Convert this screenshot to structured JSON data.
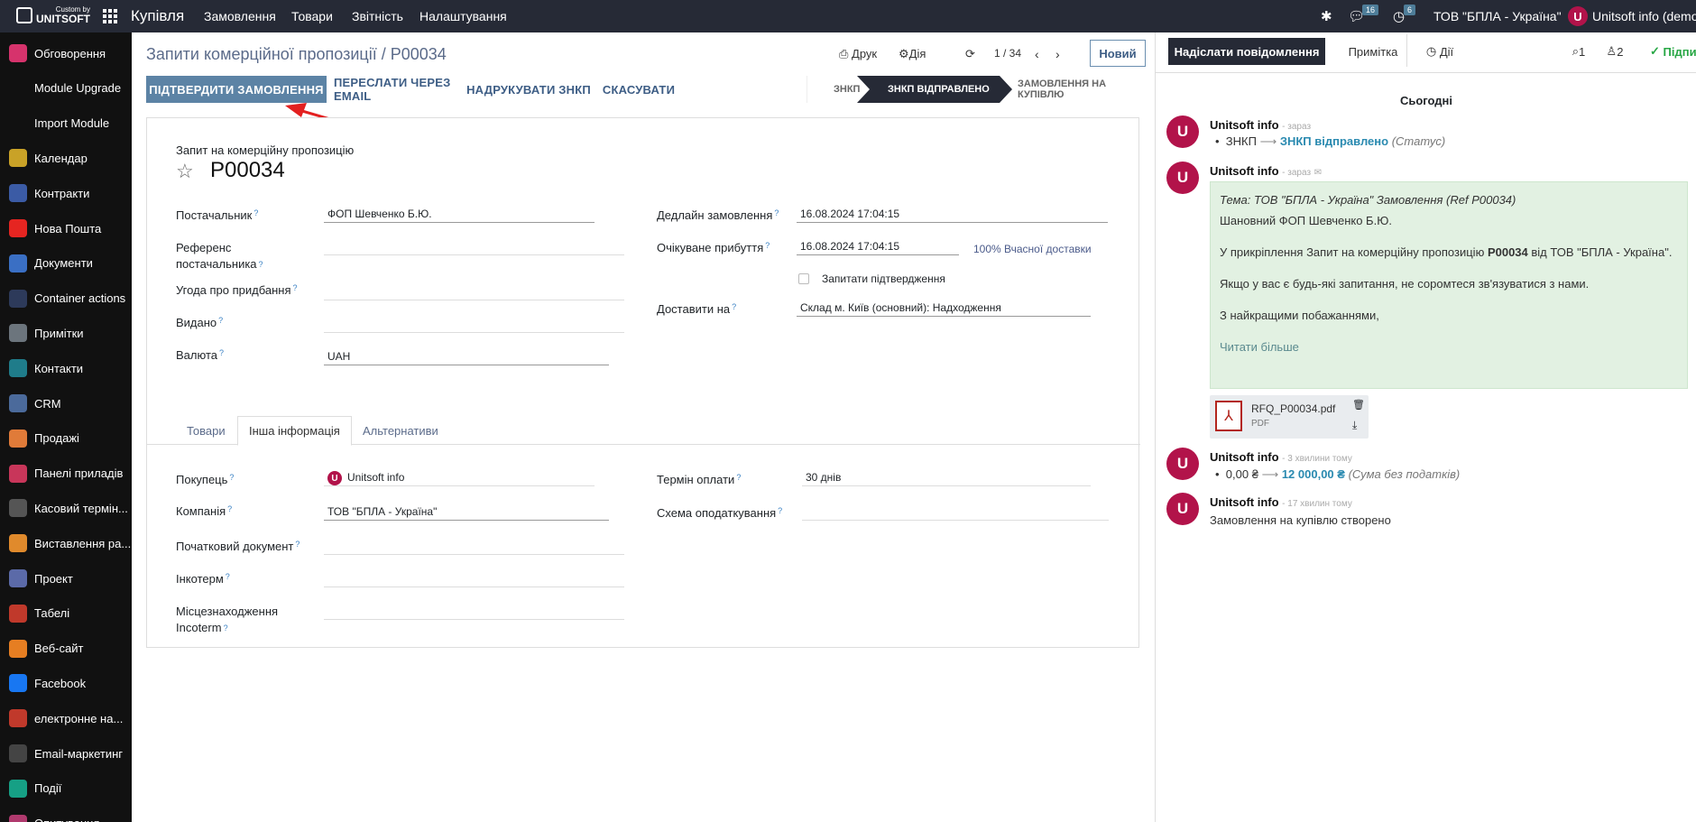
{
  "topbar": {
    "brand_small": "Custom by",
    "brand_name": "UNITSOFT",
    "app": "Купівля",
    "menu": [
      "Замовлення",
      "Товари",
      "Звітність",
      "Налаштування"
    ],
    "messages_count": "16",
    "activities_count": "6",
    "company": "ТОВ \"БПЛА - Україна\"",
    "user_initial": "U",
    "user": "Unitsoft info (demos"
  },
  "sidebar": {
    "items": [
      {
        "label": "Обговорення",
        "icon": "discuss-icon",
        "color": "#d6336c"
      },
      {
        "label": "Module Upgrade",
        "icon": "",
        "color": ""
      },
      {
        "label": "Import Module",
        "icon": "",
        "color": ""
      },
      {
        "label": "Календар",
        "icon": "calendar-icon",
        "color": "#c9a227"
      },
      {
        "label": "Контракти",
        "icon": "contracts-icon",
        "color": "#3b5ba5"
      },
      {
        "label": "Нова Пошта",
        "icon": "nova-poshta-icon",
        "color": "#e52521"
      },
      {
        "label": "Документи",
        "icon": "documents-icon",
        "color": "#3a6fc4"
      },
      {
        "label": "Container actions",
        "icon": "container-icon",
        "color": "#2d3a5a"
      },
      {
        "label": "Примітки",
        "icon": "notes-icon",
        "color": "#6c757d"
      },
      {
        "label": "Контакти",
        "icon": "contacts-icon",
        "color": "#1f7c8a"
      },
      {
        "label": "CRM",
        "icon": "crm-icon",
        "color": "#4b6a9b"
      },
      {
        "label": "Продажі",
        "icon": "sales-icon",
        "color": "#e07b39"
      },
      {
        "label": "Панелі приладів",
        "icon": "dashboards-icon",
        "color": "#c8365a"
      },
      {
        "label": "Касовий термін...",
        "icon": "pos-icon",
        "color": "#555"
      },
      {
        "label": "Виставлення ра...",
        "icon": "invoicing-icon",
        "color": "#e08a2c"
      },
      {
        "label": "Проект",
        "icon": "project-icon",
        "color": "#5b6aa8"
      },
      {
        "label": "Табелі",
        "icon": "timesheets-icon",
        "color": "#c0392b"
      },
      {
        "label": "Веб-сайт",
        "icon": "website-icon",
        "color": "#e67e22"
      },
      {
        "label": "Facebook",
        "icon": "facebook-icon",
        "color": "#1877f2"
      },
      {
        "label": "електронне на...",
        "icon": "elearning-icon",
        "color": "#c0392b"
      },
      {
        "label": "Email-маркетинг",
        "icon": "email-marketing-icon",
        "color": "#444"
      },
      {
        "label": "Події",
        "icon": "events-icon",
        "color": "#16a085"
      },
      {
        "label": "Опитування",
        "icon": "surveys-icon",
        "color": "#b03a6e"
      }
    ]
  },
  "header": {
    "breadcrumb": "Запити комерційної пропозиції / P00034",
    "print": "Друк",
    "action": "Дія",
    "pager": "1 / 34",
    "new": "Новий"
  },
  "statusbar": {
    "confirm": "ПІДТВЕРДИТИ ЗАМОВЛЕННЯ",
    "send_email": "ПЕРЕСЛАТИ ЧЕРЕЗ EMAIL",
    "print_rfq": "НАДРУКУВАТИ ЗНКП",
    "cancel": "СКАСУВАТИ",
    "stages": [
      "ЗНКП",
      "ЗНКП ВІДПРАВЛЕНО",
      "ЗАМОВЛЕННЯ НА КУПІВЛЮ"
    ],
    "active_stage": "ЗНКП ВІДПРАВЛЕНО"
  },
  "form": {
    "doc_label": "Запит на комерційну пропозицію",
    "reference": "P00034",
    "vendor_label": "Постачальник",
    "vendor": "ФОП Шевченко Б.Ю.",
    "vendor_ref_label_1": "Референс",
    "vendor_ref_label_2": "постачальника",
    "agreement_label": "Угода про придбання",
    "issued_label": "Видано",
    "currency_label": "Валюта",
    "currency": "UAH",
    "deadline_label": "Дедлайн замовлення",
    "deadline": "16.08.2024 17:04:15",
    "arrival_label": "Очікуване прибуття",
    "arrival": "16.08.2024 17:04:15",
    "ontime": "100% Вчасної доставки",
    "ask_confirm": "Запитати підтвердження",
    "deliver_to_label": "Доставити на",
    "deliver_to": "Склад м. Київ (основний): Надходження"
  },
  "tabs": [
    "Товари",
    "Інша інформація",
    "Альтернативи"
  ],
  "other_info": {
    "buyer_label": "Покупець",
    "buyer": "Unitsoft info",
    "company_label": "Компанія",
    "company": "ТОВ \"БПЛА - Україна\"",
    "source_label": "Початковий документ",
    "incoterm_label": "Інкотерм",
    "incoterm_loc_label_1": "Місцезнаходження",
    "incoterm_loc_label_2": "Incoterm",
    "payment_terms_label": "Термін оплати",
    "payment_terms": "30 днів",
    "fiscal_label": "Схема оподаткування"
  },
  "chatter": {
    "send_message": "Надіслати повідомлення",
    "log_note": "Примітка",
    "activities": "Дії",
    "attachments_count": "1",
    "followers_count": "2",
    "follow": "Підпи",
    "today": "Сьогодні",
    "messages": [
      {
        "author": "Unitsoft info",
        "time": "- зараз",
        "old": "ЗНКП",
        "new": "ЗНКП відправлено",
        "field": "(Статус)"
      },
      {
        "author": "Unitsoft info",
        "time": "- зараз"
      },
      {
        "author": "Unitsoft info",
        "time": "- 3 хвилини тому",
        "old": "0,00 ₴",
        "new": "12 000,00 ₴",
        "field": "(Сума без податків)"
      },
      {
        "author": "Unitsoft info",
        "time": "- 17 хвилин тому",
        "text": "Замовлення на купівлю створено"
      }
    ],
    "email": {
      "subject": "Тема: ТОВ \"БПЛА - Україна\" Замовлення (Ref P00034)",
      "greeting": "Шановний ФОП Шевченко Б.Ю.",
      "body_pre": "У прикріплення Запит на комерційну пропозицію ",
      "body_ref": "P00034",
      "body_post": " від ТОВ \"БПЛА - Україна\".",
      "questions": "Якщо у вас є будь-які запитання, не соромтеся зв'язуватися з нами.",
      "regards": "З найкращими побажаннями,",
      "read_more": "Читати більше"
    },
    "attachment": {
      "name": "RFQ_P00034.pdf",
      "type": "PDF"
    }
  }
}
